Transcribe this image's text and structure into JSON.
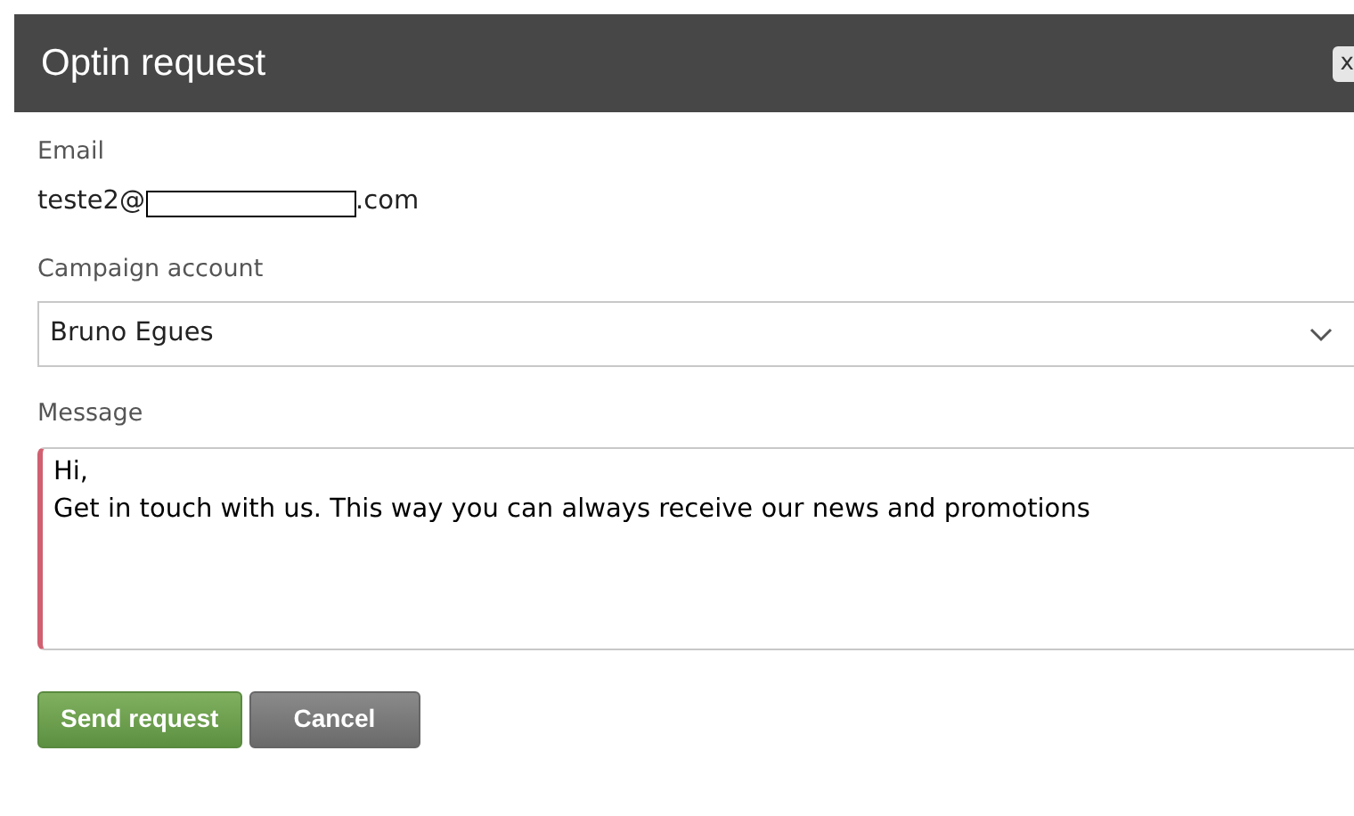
{
  "dialog": {
    "title": "Optin request",
    "close": "x"
  },
  "email": {
    "label": "Email",
    "value_start": "teste2@",
    "value_end": ".com"
  },
  "campaign_account": {
    "label": "Campaign account",
    "value": "Bruno Egues"
  },
  "message": {
    "label": "Message",
    "value": "Hi,\nGet in touch with us. This way you can always receive our news and promotions",
    "invalid": true
  },
  "buttons": [
    {
      "label": "Send request",
      "kind": "primary"
    },
    {
      "label": "Cancel",
      "kind": "secondary"
    }
  ]
}
